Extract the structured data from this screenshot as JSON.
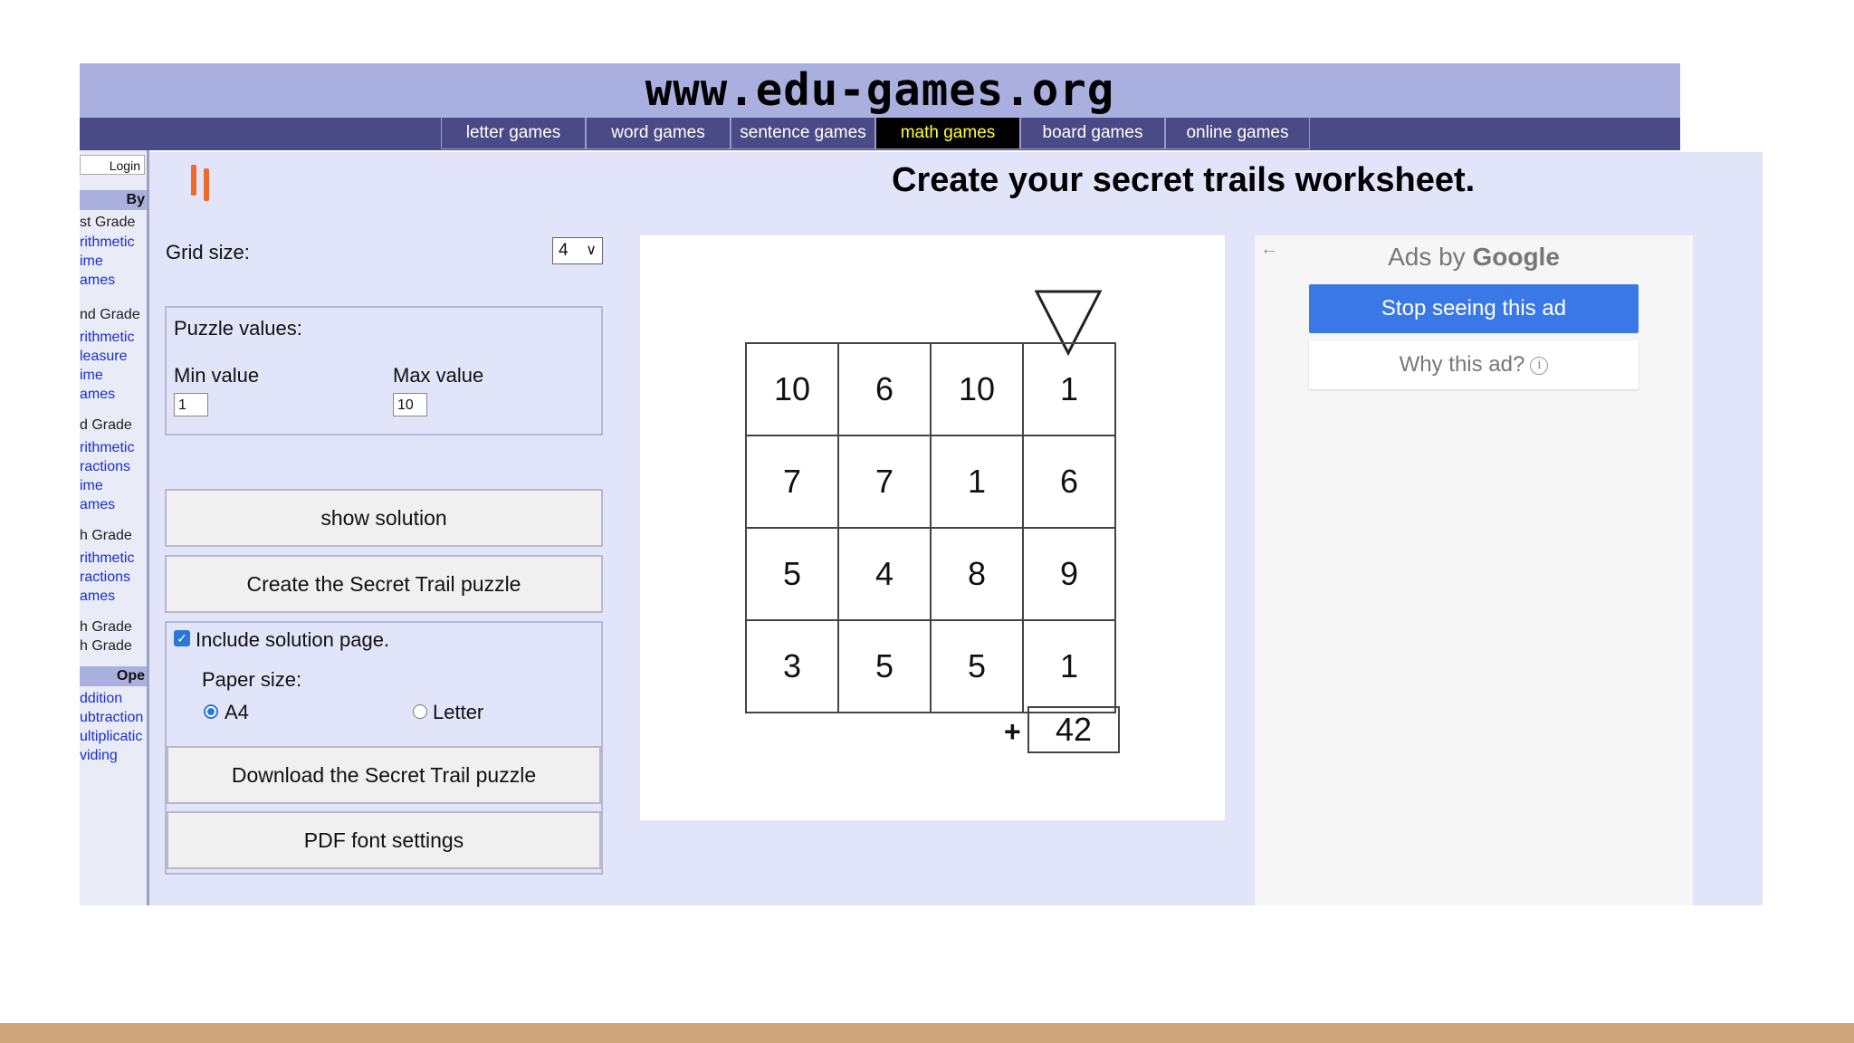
{
  "site": {
    "title": "www.edu-games.org"
  },
  "nav": {
    "tabs": [
      {
        "label": "letter games"
      },
      {
        "label": "word games"
      },
      {
        "label": "sentence games"
      },
      {
        "label": "math games",
        "active": true
      },
      {
        "label": "board games"
      },
      {
        "label": "online games"
      }
    ]
  },
  "sidebar": {
    "login": "Login",
    "by_heading": "By",
    "grade1": "st Grade",
    "grade1_links": [
      "rithmetic",
      "ime",
      "ames"
    ],
    "grade2": "nd Grade",
    "grade2_links": [
      "rithmetic",
      "leasure",
      "ime",
      "ames"
    ],
    "grade3": "d Grade",
    "grade3_links": [
      "rithmetic",
      "ractions",
      "ime",
      "ames"
    ],
    "grade4": "h Grade",
    "grade4_links": [
      "rithmetic",
      "ractions",
      "ames"
    ],
    "grade5": "h Grade",
    "grade6": "h Grade",
    "ops_heading": "Ope",
    "ops_links": [
      "ddition",
      "ubtraction",
      "ultiplicatic",
      "viding"
    ]
  },
  "main": {
    "title": "Create your secret trails worksheet.",
    "grid_size_label": "Grid size:",
    "grid_size_value": "4",
    "puzzle_values_label": "Puzzle values:",
    "min_label": "Min value",
    "min_value": "1",
    "max_label": "Max value",
    "max_value": "10",
    "show_solution": "show solution",
    "create_button": "Create the Secret Trail puzzle",
    "include_solution": "Include solution page.",
    "include_solution_checked": true,
    "paper_size_label": "Paper size:",
    "paper_a4": "A4",
    "paper_letter": "Letter",
    "paper_selected": "A4",
    "download_button": "Download the Secret Trail puzzle",
    "pdf_font_button": "PDF font settings"
  },
  "puzzle": {
    "grid": [
      [
        "10",
        "6",
        "10",
        "1"
      ],
      [
        "7",
        "7",
        "1",
        "6"
      ],
      [
        "5",
        "4",
        "8",
        "9"
      ],
      [
        "3",
        "5",
        "5",
        "1"
      ]
    ],
    "operator": "+",
    "target": "42"
  },
  "ads": {
    "ads_by": "Ads by",
    "google": "Google",
    "stop": "Stop seeing this ad",
    "why": "Why this ad?",
    "info_glyph": "i"
  },
  "colors": {
    "banner": "#a9b0df",
    "navbar": "#4a4a86",
    "active_tab_text": "#ffff33",
    "main_bg": "#e2e4fa",
    "ad_blue": "#3b78e7",
    "footer": "#cfa67a"
  }
}
